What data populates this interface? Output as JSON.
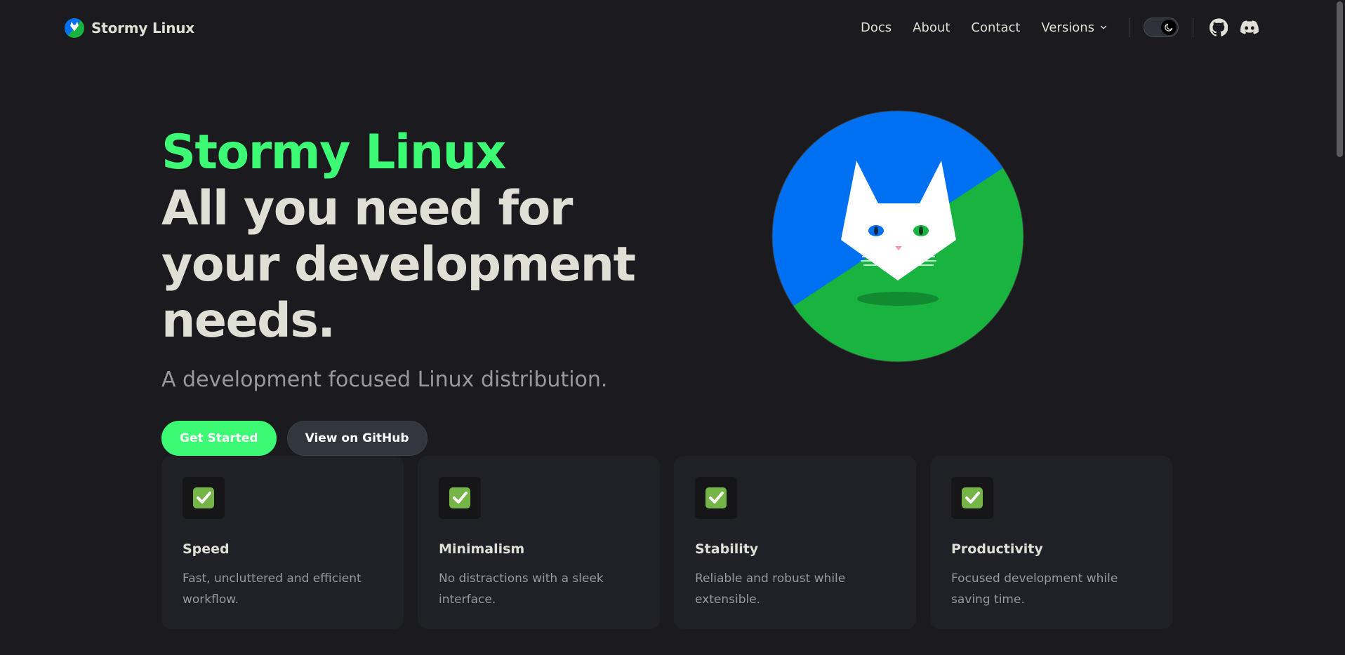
{
  "navbar": {
    "brand_title": "Stormy Linux",
    "links": [
      {
        "label": "Docs"
      },
      {
        "label": "About"
      },
      {
        "label": "Contact"
      }
    ],
    "versions_label": "Versions",
    "theme": "dark"
  },
  "hero": {
    "name": "Stormy Linux",
    "tagline": "All you need for your development needs.",
    "subtitle": "A development focused Linux distribution.",
    "actions": {
      "primary_label": "Get Started",
      "secondary_label": "View on GitHub"
    }
  },
  "features": [
    {
      "icon": "check-mark-icon",
      "title": "Speed",
      "details": "Fast, uncluttered and efficient workflow."
    },
    {
      "icon": "check-mark-icon",
      "title": "Minimalism",
      "details": "No distractions with a sleek interface."
    },
    {
      "icon": "check-mark-icon",
      "title": "Stability",
      "details": "Reliable and robust while extensible."
    },
    {
      "icon": "check-mark-icon",
      "title": "Productivity",
      "details": "Focused development while saving time."
    }
  ],
  "colors": {
    "background": "#1b1b1f",
    "brand_green": "#3dfa74",
    "logo_blue": "#0070f3",
    "logo_green": "#19b33f",
    "card_bg": "#202127",
    "text_primary": "#dfdfd6",
    "text_muted": "#98989f"
  }
}
